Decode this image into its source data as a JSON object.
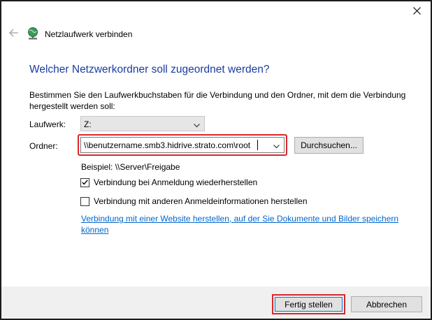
{
  "window": {
    "title": "Netzlaufwerk verbinden",
    "icons": {
      "close": "close-icon",
      "back": "back-arrow-icon",
      "app": "network-drive-icon"
    }
  },
  "main": {
    "heading": "Welcher Netzwerkordner soll zugeordnet werden?",
    "description": "Bestimmen Sie den Laufwerkbuchstaben für die Verbindung und den Ordner, mit dem die Verbindung hergestellt werden soll:",
    "drive": {
      "label": "Laufwerk:",
      "value": "Z:"
    },
    "folder": {
      "label": "Ordner:",
      "value": "\\\\benutzername.smb3.hidrive.strato.com\\root"
    },
    "browse_label": "Durchsuchen...",
    "example": "Beispiel: \\\\Server\\Freigabe",
    "checkbox_reconnect": {
      "label": "Verbindung bei Anmeldung wiederherstellen",
      "checked": true
    },
    "checkbox_credentials": {
      "label": "Verbindung mit anderen Anmeldeinformationen herstellen",
      "checked": false
    },
    "link": "Verbindung mit einer Website herstellen, auf der Sie Dokumente und Bilder speichern können"
  },
  "footer": {
    "finish_label": "Fertig stellen",
    "cancel_label": "Abbrechen"
  },
  "colors": {
    "heading": "#1a3c9e",
    "highlight": "#d9262c",
    "link": "#0066cc",
    "footer_bg": "#f0f0f0"
  }
}
